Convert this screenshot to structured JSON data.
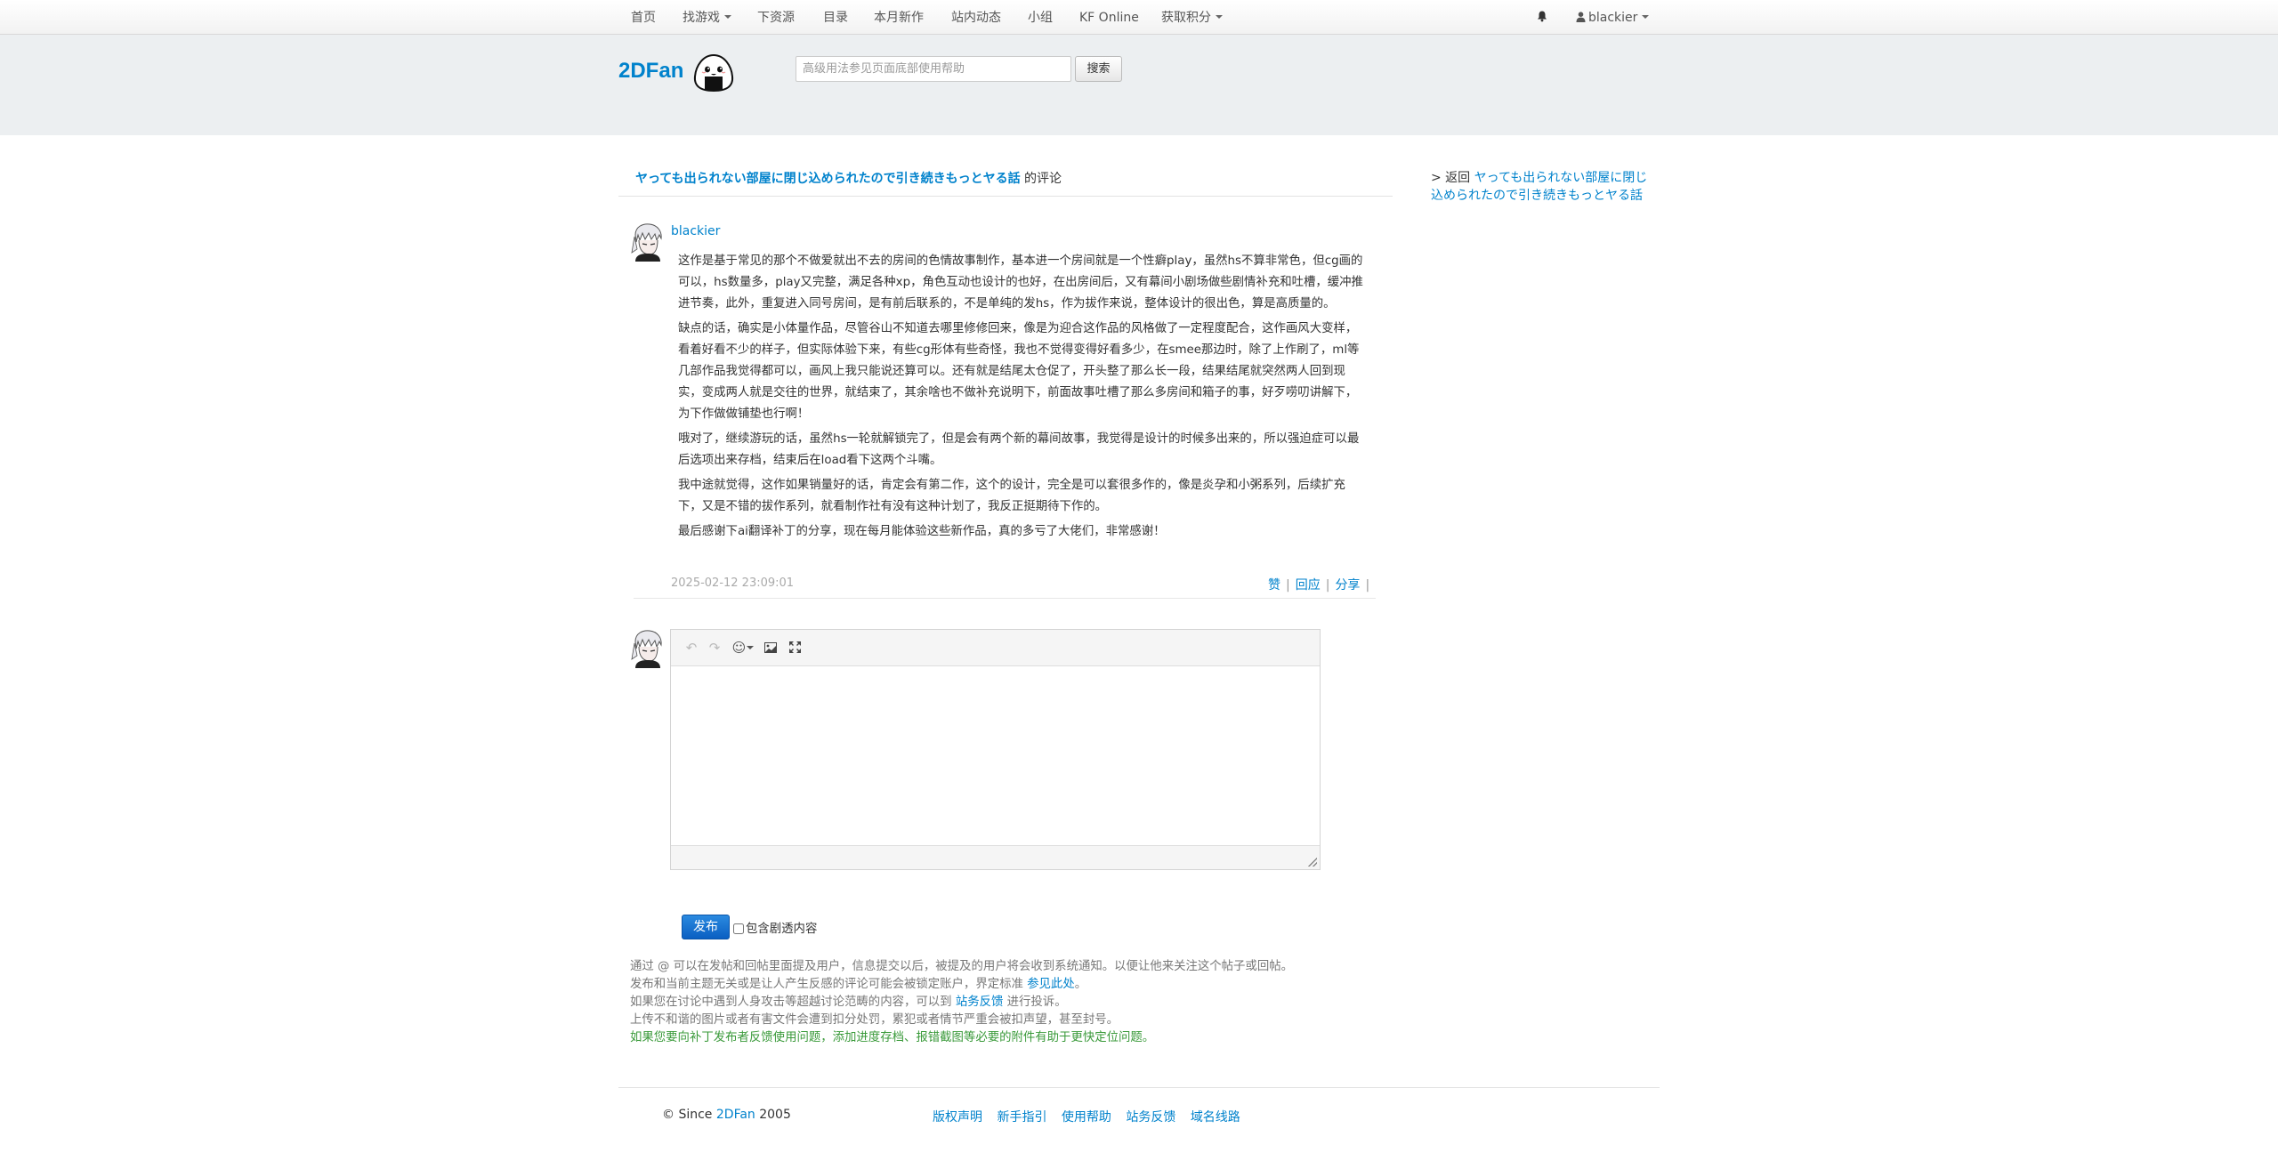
{
  "nav": {
    "items": [
      {
        "label": "首页"
      },
      {
        "label": "找游戏"
      },
      {
        "label": "下资源"
      },
      {
        "label": "目录"
      },
      {
        "label": "本月新作"
      },
      {
        "label": "站内动态"
      },
      {
        "label": "小组"
      },
      {
        "label": "KF Online"
      },
      {
        "label": "获取积分"
      }
    ],
    "user": "blackier"
  },
  "header": {
    "logo": "2DFan",
    "search_placeholder": "高级用法参见页面底部使用帮助",
    "search_button": "搜索"
  },
  "breadcrumb": {
    "title": "ヤっても出られない部屋に閉じ込められたので引き続きもっとヤる話",
    "suffix": " 的评论"
  },
  "comment": {
    "author": "blackier",
    "paragraphs": [
      "这作是基于常见的那个不做爱就出不去的房间的色情故事制作，基本进一个房间就是一个性癖play，虽然hs不算非常色，但cg画的可以，hs数量多，play又完整，满足各种xp，角色互动也设计的也好，在出房间后，又有幕间小剧场做些剧情补充和吐槽，缓冲推进节奏，此外，重复进入同号房间，是有前后联系的，不是单纯的发hs，作为拔作来说，整体设计的很出色，算是高质量的。",
      "缺点的话，确实是小体量作品，尽管谷山不知道去哪里修修回来，像是为迎合这作品的风格做了一定程度配合，这作画风大变样，看着好看不少的样子，但实际体验下来，有些cg形体有些奇怪，我也不觉得变得好看多少，在smee那边时，除了上作刷了，ml等几部作品我觉得都可以，画风上我只能说还算可以。还有就是结尾太仓促了，开头整了那么长一段，结果结尾就突然两人回到现实，变成两人就是交往的世界，就结束了，其余啥也不做补充说明下，前面故事吐槽了那么多房间和箱子的事，好歹唠叨讲解下，为下作做做铺垫也行啊！",
      "哦对了，继续游玩的话，虽然hs一轮就解锁完了，但是会有两个新的幕间故事，我觉得是设计的时候多出来的，所以强迫症可以最后选项出来存档，结束后在load看下这两个斗嘴。",
      "我中途就觉得，这作如果销量好的话，肯定会有第二作，这个的设计，完全是可以套很多作的，像是炎孕和小粥系列，后续扩充下，又是不错的拔作系列，就看制作社有没有这种计划了，我反正挺期待下作的。",
      "最后感谢下ai翻译补丁的分享，现在每月能体验这些新作品，真的多亏了大佬们，非常感谢！"
    ],
    "timestamp": "2025-02-12 23:09:01",
    "actions": [
      "赞",
      "回应",
      "分享"
    ]
  },
  "editor": {
    "post_button": "发布",
    "spoiler_label": "包含剧透内容"
  },
  "notes": {
    "line1": "通过 @ 可以在发帖和回帖里面提及用户，信息提交以后，被提及的用户将会收到系统通知。以便让他来关注这个帖子或回帖。",
    "line2_pre": "发布和当前主题无关或是让人产生反感的评论可能会被锁定账户，界定标准 ",
    "line2_link": "参见此处",
    "line2_post": "。",
    "line3_pre": "如果您在讨论中遇到人身攻击等超越讨论范畴的内容，可以到 ",
    "line3_link": "站务反馈",
    "line3_post": " 进行投诉。",
    "line4": "上传不和谐的图片或者有害文件会遭到扣分处罚，累犯或者情节严重会被扣声望，甚至封号。",
    "line5": "如果您要向补丁发布者反馈使用问题，添加进度存档、报错截图等必要的附件有助于更快定位问题。"
  },
  "sidebar": {
    "back_prefix": "> 返回 ",
    "back_title": "ヤっても出られない部屋に閉じ込められたので引き続きもっとヤる話"
  },
  "footer": {
    "since_pre": "© Since ",
    "brand": "2DFan",
    "since_year": " 2005",
    "links": [
      "版权声明",
      "新手指引",
      "使用帮助",
      "站务反馈",
      "域名线路"
    ]
  }
}
